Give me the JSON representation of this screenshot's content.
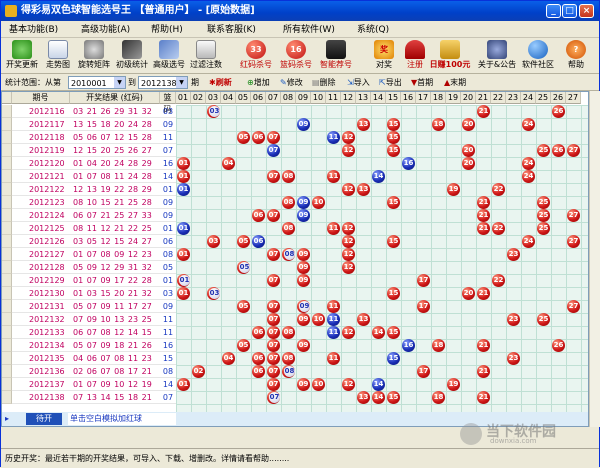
{
  "window": {
    "title": "得彩易双色球智能选号王 【普通用户】 - [原始数据]"
  },
  "menu": [
    "基本功能(B)",
    "高级功能(A)",
    "帮助(H)",
    "联系客服(K)",
    "所有软件(W)",
    "系统(Q)"
  ],
  "toolbar": [
    {
      "label": "开奖更新",
      "icon": "plus-update-icon"
    },
    {
      "label": "走势图",
      "icon": "chart-icon"
    },
    {
      "label": "旋转矩阵",
      "icon": "gear-icon"
    },
    {
      "label": "初级统计",
      "icon": "stats-icon"
    },
    {
      "label": "高级选号",
      "icon": "pick-icon"
    },
    {
      "label": "过滤注数",
      "icon": "filter-icon"
    },
    {
      "label": "红码杀号",
      "icon": "red-ball-icon",
      "badge": "33"
    },
    {
      "label": "篮码杀号",
      "icon": "blue-ball-icon",
      "badge": "16"
    },
    {
      "label": "智能荐号",
      "icon": "smart-icon"
    },
    {
      "label": "对奖",
      "icon": "prize-icon"
    },
    {
      "label": "注册",
      "icon": "register-icon"
    },
    {
      "label": "日赚100元",
      "icon": "money-icon"
    },
    {
      "label": "关于&公告",
      "icon": "people-icon"
    },
    {
      "label": "软件社区",
      "icon": "globe-icon"
    },
    {
      "label": "帮助",
      "icon": "help-icon"
    }
  ],
  "filter": {
    "range_label": "统计范围：从第",
    "from_value": "2010001",
    "to_label": "到",
    "to_value": "2012138",
    "period_label": "期",
    "refresh": "刷新",
    "add": "增加",
    "edit": "修改",
    "delete": "删除",
    "import": "导入",
    "export": "导出",
    "first": "首期",
    "last": "末期"
  },
  "grid": {
    "headers": {
      "issue": "期号",
      "result": "开奖结果 (红码)",
      "blue": "篮码"
    },
    "number_headers": [
      "01",
      "02",
      "03",
      "04",
      "05",
      "06",
      "07",
      "08",
      "09",
      "10",
      "11",
      "12",
      "13",
      "14",
      "15",
      "16",
      "17",
      "18",
      "19",
      "20",
      "21",
      "22",
      "23",
      "24",
      "25",
      "26",
      "27"
    ],
    "rows": [
      {
        "issue": "2012116",
        "reds": "03 21 26 29 31 32",
        "blue": "03"
      },
      {
        "issue": "2012117",
        "reds": "13 15 18 20 24 28",
        "blue": "09"
      },
      {
        "issue": "2012118",
        "reds": "05 06 07 12 15 28",
        "blue": "11"
      },
      {
        "issue": "2012119",
        "reds": "12 15 20 25 26 27",
        "blue": "07"
      },
      {
        "issue": "2012120",
        "reds": "01 04 20 24 28 29",
        "blue": "16"
      },
      {
        "issue": "2012121",
        "reds": "01 07 08 11 24 28",
        "blue": "14"
      },
      {
        "issue": "2012122",
        "reds": "12 13 19 22 28 29",
        "blue": "01"
      },
      {
        "issue": "2012123",
        "reds": "08 10 15 21 25 28",
        "blue": "09"
      },
      {
        "issue": "2012124",
        "reds": "06 07 21 25 27 33",
        "blue": "09"
      },
      {
        "issue": "2012125",
        "reds": "08 11 12 21 22 25",
        "blue": "01"
      },
      {
        "issue": "2012126",
        "reds": "03 05 12 15 24 27",
        "blue": "06"
      },
      {
        "issue": "2012127",
        "reds": "01 07 08 09 12 23",
        "blue": "08"
      },
      {
        "issue": "2012128",
        "reds": "05 09 12 29 31 32",
        "blue": "05"
      },
      {
        "issue": "2012129",
        "reds": "01 07 09 17 22 28",
        "blue": "01"
      },
      {
        "issue": "2012130",
        "reds": "01 03 15 20 21 32",
        "blue": "03"
      },
      {
        "issue": "2012131",
        "reds": "05 07 09 11 17 27",
        "blue": "09"
      },
      {
        "issue": "2012132",
        "reds": "07 09 10 13 23 25",
        "blue": "11"
      },
      {
        "issue": "2012133",
        "reds": "06 07 08 12 14 15",
        "blue": "11"
      },
      {
        "issue": "2012134",
        "reds": "05 07 09 18 21 26",
        "blue": "16"
      },
      {
        "issue": "2012135",
        "reds": "04 06 07 08 11 23",
        "blue": "15"
      },
      {
        "issue": "2012136",
        "reds": "02 06 07 08 17 21",
        "blue": "08"
      },
      {
        "issue": "2012137",
        "reds": "01 07 09 10 12 19",
        "blue": "14"
      },
      {
        "issue": "2012138",
        "reds": "07 13 14 15 18 21",
        "blue": "07"
      }
    ],
    "open_button": "待开",
    "hint": "单击空白模拟加红球"
  },
  "status": {
    "text": "历史开奖：最近若干期的开奖结果，可导入、下载、增删改。详情请看帮助........"
  },
  "watermark": {
    "text": "当下软件园",
    "sub": "downxia.com"
  }
}
